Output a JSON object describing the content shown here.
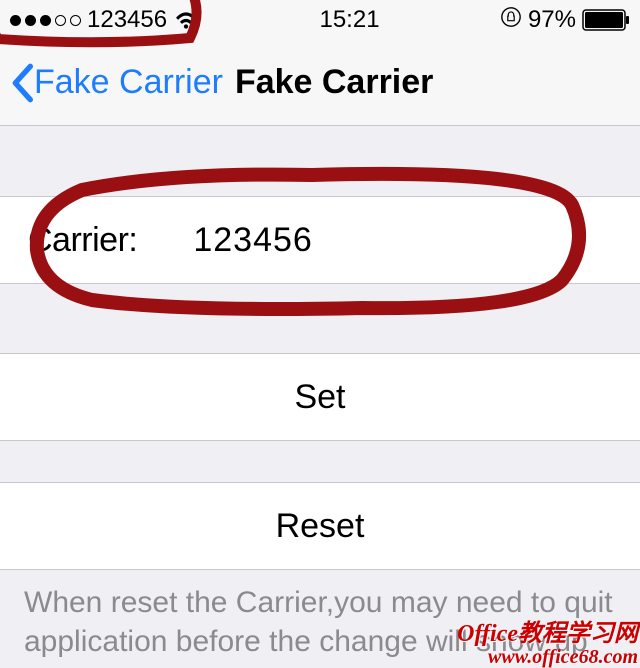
{
  "status": {
    "carrier": "123456",
    "time": "15:21",
    "battery_pct": "97%"
  },
  "nav": {
    "back_label": "Fake Carrier",
    "title": "Fake Carrier"
  },
  "carrier_row": {
    "label": "Carrier:",
    "value": "123456"
  },
  "actions": {
    "set": "Set",
    "reset": "Reset"
  },
  "footer": "When reset the Carrier,you may need to quit application before the change will show up",
  "watermark": {
    "line1": "Office教程学习网",
    "line2": "www.office68.com"
  },
  "colors": {
    "tint": "#1e7dff",
    "annotation": "#9a0f12"
  }
}
